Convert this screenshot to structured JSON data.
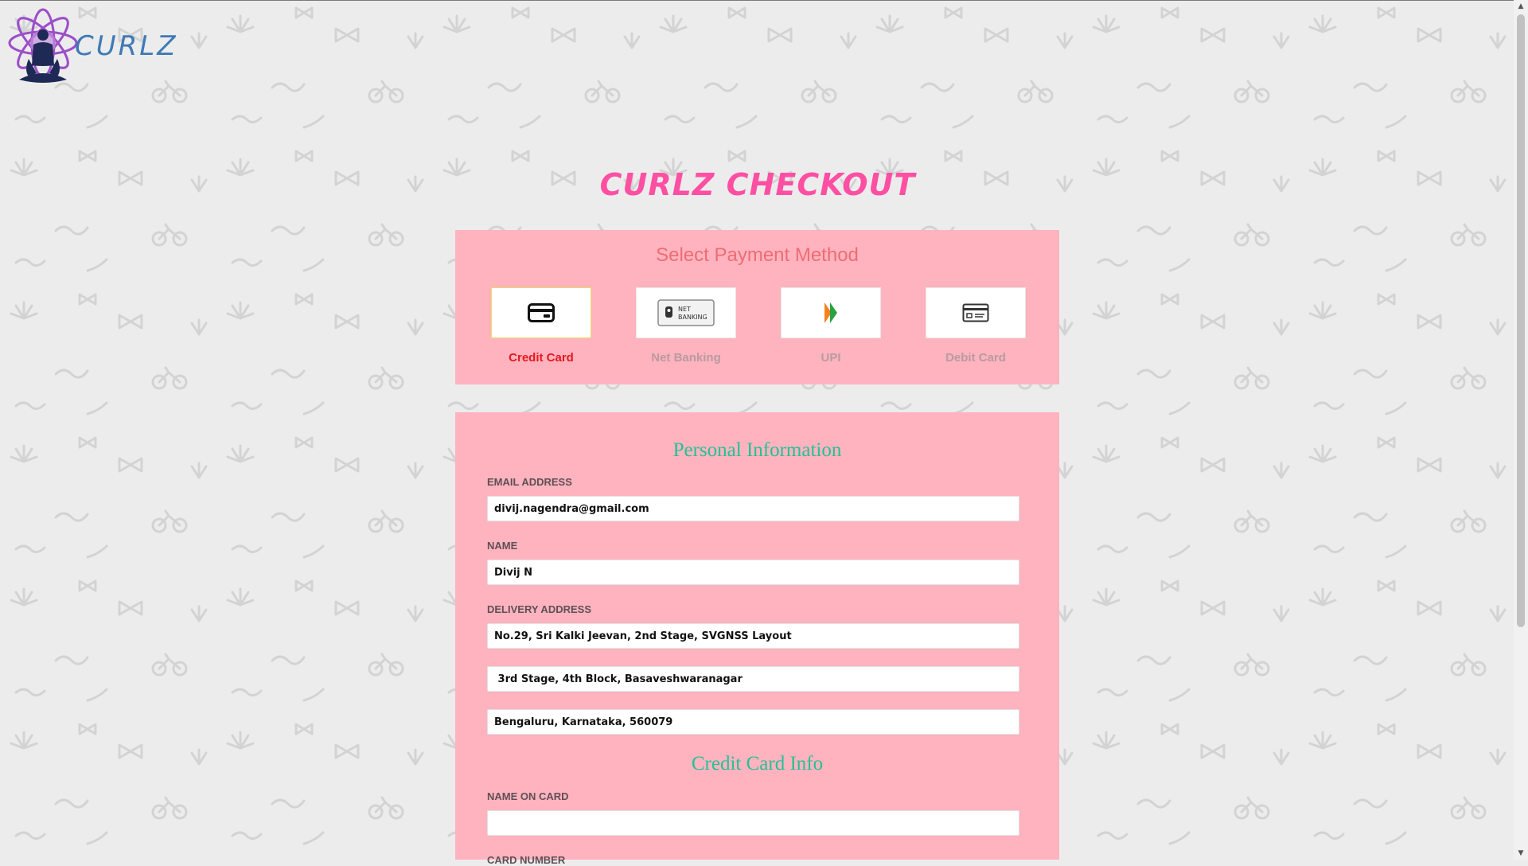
{
  "brand": {
    "logo_text": "CURLZ",
    "logo_icon": "meditation-lotus-logo"
  },
  "page": {
    "title": "CURLZ CHECKOUT"
  },
  "payment": {
    "title": "Select Payment Method",
    "methods": [
      {
        "label": "Credit Card",
        "icon": "credit-card-icon",
        "selected": true
      },
      {
        "label": "Net Banking",
        "icon": "net-banking-icon",
        "icon_text_1": "NET",
        "icon_text_2": "BANKING",
        "selected": false
      },
      {
        "label": "UPI",
        "icon": "upi-icon",
        "selected": false
      },
      {
        "label": "Debit Card",
        "icon": "debit-card-icon",
        "selected": false
      }
    ]
  },
  "personal": {
    "title": "Personal Information",
    "email_label": "EMAIL ADDRESS",
    "email_value": "divij.nagendra@gmail.com",
    "name_label": "NAME",
    "name_value": "Divij N",
    "address_label": "DELIVERY ADDRESS",
    "address_line1": "No.29, Sri Kalki Jeevan, 2nd Stage, SVGNSS Layout",
    "address_line2": " 3rd Stage, 4th Block, Basaveshwaranagar",
    "address_line3": "Bengaluru, Karnataka, 560079"
  },
  "card": {
    "title": "Credit Card Info",
    "name_on_card_label": "NAME ON CARD",
    "name_on_card_value": "",
    "card_number_label": "CARD NUMBER"
  },
  "colors": {
    "title_pink": "#ff4fa3",
    "panel_pink": "#ffb3bf",
    "section_green": "#24c196",
    "pay_title_coral": "#ee6d72",
    "active_red": "#e5181e",
    "page_bg": "#ececec"
  }
}
